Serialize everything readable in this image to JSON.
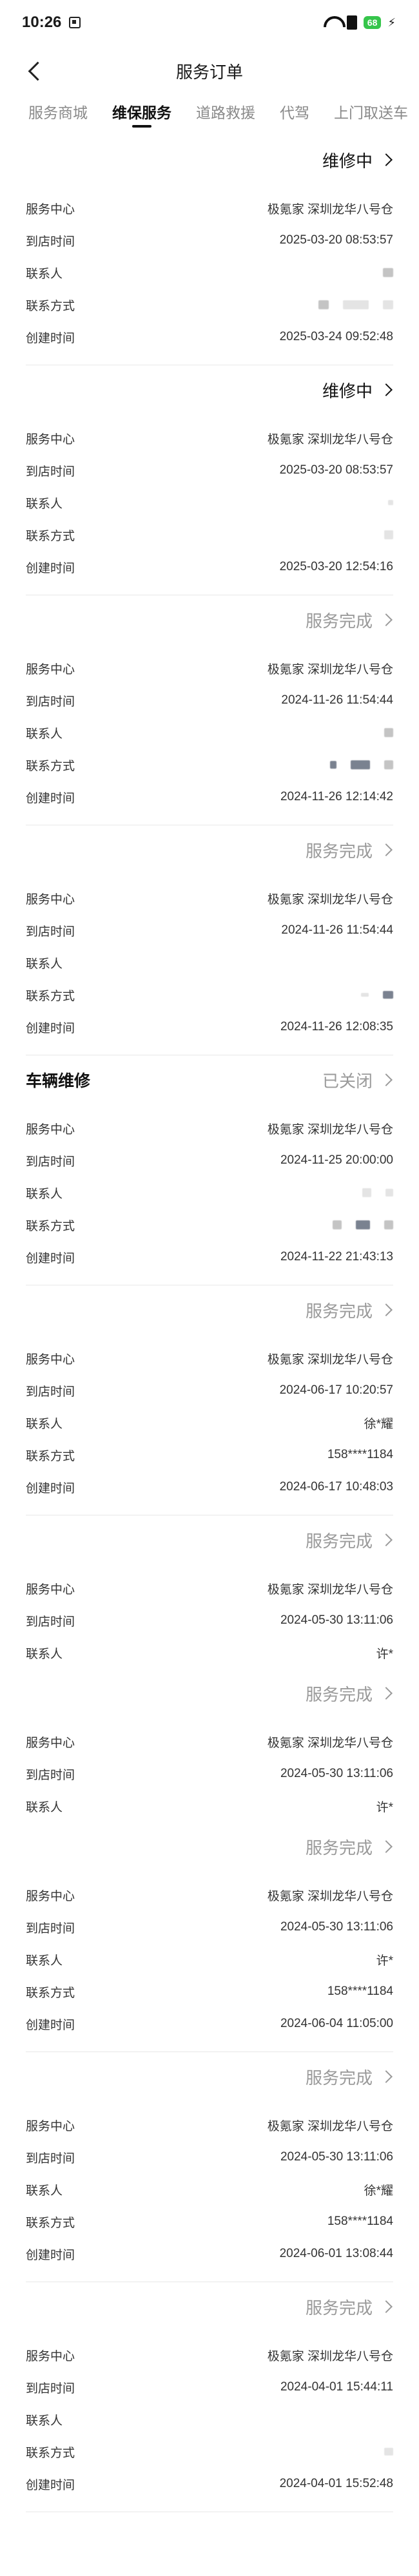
{
  "status_bar": {
    "time": "10:26",
    "battery": "68"
  },
  "nav": {
    "title": "服务订单"
  },
  "tabs": [
    {
      "label": "服务商城",
      "active": false
    },
    {
      "label": "维保服务",
      "active": true
    },
    {
      "label": "道路救援",
      "active": false
    },
    {
      "label": "代驾",
      "active": false
    },
    {
      "label": "上门取送车",
      "active": false
    }
  ],
  "field_labels": {
    "center": "服务中心",
    "arrival": "到店时间",
    "contact": "联系人",
    "phone": "联系方式",
    "created": "创建时间"
  },
  "orders": [
    {
      "type": "",
      "status": "维修中",
      "status_style": "dark",
      "center": "极氪家 深圳龙华八号仓",
      "arrival": "2025-03-20 08:53:57",
      "contact": "",
      "phone": "",
      "created": "2025-03-24 09:52:48"
    },
    {
      "type": "",
      "status": "维修中",
      "status_style": "dark",
      "center": "极氪家 深圳龙华八号仓",
      "arrival": "2025-03-20 08:53:57",
      "contact": "",
      "phone": "",
      "created": "2025-03-20 12:54:16"
    },
    {
      "type": "",
      "status": "服务完成",
      "status_style": "gray",
      "center": "极氪家 深圳龙华八号仓",
      "arrival": "2024-11-26 11:54:44",
      "contact": "",
      "phone": "",
      "created": "2024-11-26 12:14:42"
    },
    {
      "type": "",
      "status": "服务完成",
      "status_style": "gray",
      "center": "极氪家 深圳龙华八号仓",
      "arrival": "2024-11-26 11:54:44",
      "contact": "",
      "phone": "",
      "created": "2024-11-26 12:08:35"
    },
    {
      "type": "车辆维修",
      "status": "已关闭",
      "status_style": "gray",
      "center": "极氪家 深圳龙华八号仓",
      "arrival": "2024-11-25 20:00:00",
      "contact": "",
      "phone": "",
      "created": "2024-11-22 21:43:13"
    },
    {
      "type": "",
      "status": "服务完成",
      "status_style": "gray",
      "center": "极氪家 深圳龙华八号仓",
      "arrival": "2024-06-17 10:20:57",
      "contact": "徐*耀",
      "phone": "158****1184",
      "created": "2024-06-17 10:48:03"
    },
    {
      "type": "",
      "status": "服务完成",
      "status_style": "gray",
      "center": "极氪家 深圳龙华八号仓",
      "arrival": "2024-05-30 13:11:06",
      "contact": "许*",
      "phone": null,
      "created": null
    },
    {
      "type": "",
      "status": "服务完成",
      "status_style": "gray",
      "center": "极氪家 深圳龙华八号仓",
      "arrival": "2024-05-30 13:11:06",
      "contact": "许*",
      "phone": null,
      "created": null
    },
    {
      "type": "",
      "status": "服务完成",
      "status_style": "gray",
      "center": "极氪家 深圳龙华八号仓",
      "arrival": "2024-05-30 13:11:06",
      "contact": "许*",
      "phone": "158****1184",
      "created": "2024-06-04 11:05:00"
    },
    {
      "type": "",
      "status": "服务完成",
      "status_style": "gray",
      "center": "极氪家 深圳龙华八号仓",
      "arrival": "2024-05-30 13:11:06",
      "contact": "徐*耀",
      "phone": "158****1184",
      "created": "2024-06-01 13:08:44"
    },
    {
      "type": "",
      "status": "服务完成",
      "status_style": "gray",
      "center": "极氪家 深圳龙华八号仓",
      "arrival": "2024-04-01 15:44:11",
      "contact": "",
      "phone": "",
      "created": "2024-04-01 15:52:48"
    }
  ]
}
